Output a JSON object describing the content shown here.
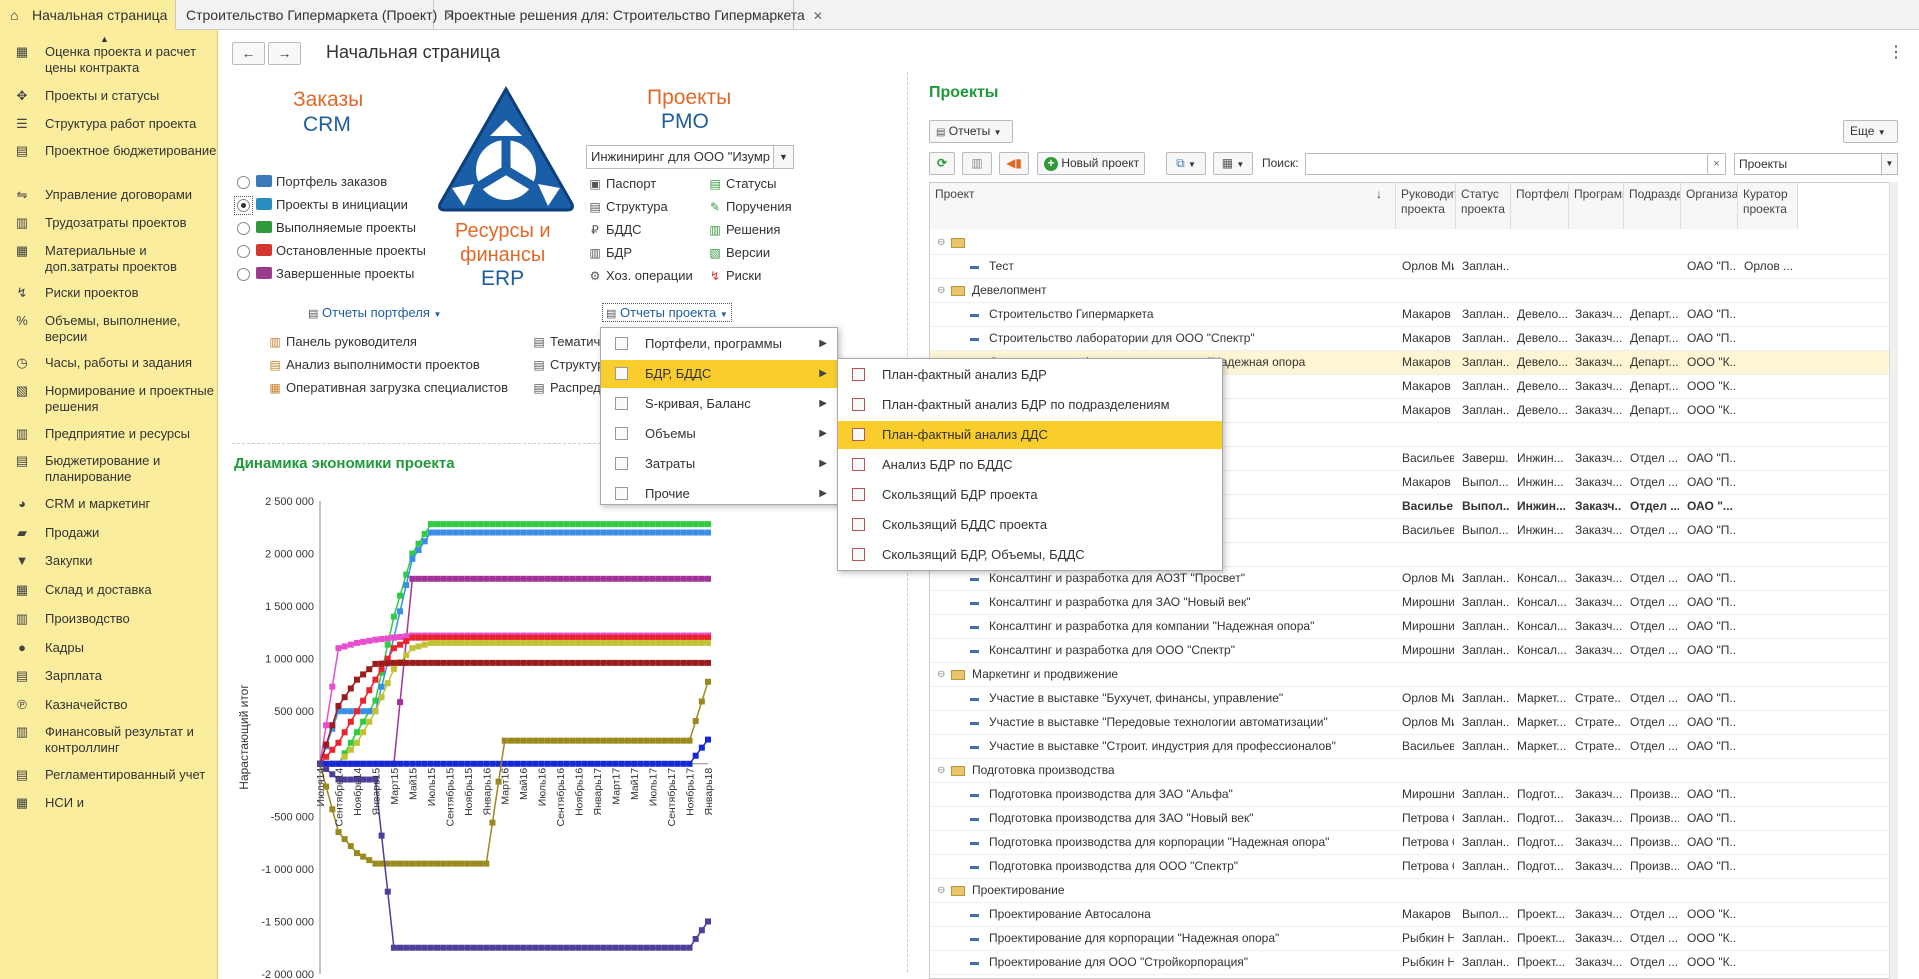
{
  "tabs": [
    {
      "label": "Начальная страница",
      "active": true
    },
    {
      "label": "Строительство Гипермаркета (Проект)"
    },
    {
      "label": "Проектные решения для: Строительство Гипермаркета"
    }
  ],
  "sidebar": [
    {
      "label": "Оценка проекта и расчет цены контракта",
      "icon": "calculator-icon"
    },
    {
      "label": "Проекты и статусы",
      "icon": "projects-icon"
    },
    {
      "label": "Структура работ проекта",
      "icon": "structure-icon"
    },
    {
      "label": "Проектное бюджетирование",
      "icon": "budget-icon"
    },
    {
      "label": "Управление договорами",
      "icon": "handshake-icon"
    },
    {
      "label": "Трудозатраты проектов",
      "icon": "labor-icon"
    },
    {
      "label": "Материальные и доп.затраты проектов",
      "icon": "materials-icon"
    },
    {
      "label": "Риски проектов",
      "icon": "risk-icon"
    },
    {
      "label": "Объемы, выполнение, версии",
      "icon": "percent-icon"
    },
    {
      "label": "Часы, работы и задания",
      "icon": "clock-icon"
    },
    {
      "label": "Нормирование и проектные решения",
      "icon": "norm-icon"
    },
    {
      "label": "Предприятие и ресурсы",
      "icon": "enterprise-icon"
    },
    {
      "label": "Бюджетирование и планирование",
      "icon": "planning-icon"
    },
    {
      "label": "CRM и маркетинг",
      "icon": "crm-icon"
    },
    {
      "label": "Продажи",
      "icon": "sales-icon"
    },
    {
      "label": "Закупки",
      "icon": "cart-icon"
    },
    {
      "label": "Склад и доставка",
      "icon": "warehouse-icon"
    },
    {
      "label": "Производство",
      "icon": "factory-icon"
    },
    {
      "label": "Кадры",
      "icon": "person-icon"
    },
    {
      "label": "Зарплата",
      "icon": "salary-icon"
    },
    {
      "label": "Казначейство",
      "icon": "treasury-icon"
    },
    {
      "label": "Финансовый результат и контроллинг",
      "icon": "chart-icon"
    },
    {
      "label": "Регламентированный учет",
      "icon": "accounting-icon"
    },
    {
      "label": "НСИ и",
      "icon": "nsi-icon"
    }
  ],
  "page": {
    "title": "Начальная страница",
    "back": "←",
    "forward": "→",
    "more": "⋮"
  },
  "brand": {
    "crm_line1": "Заказы",
    "crm_line2": "CRM",
    "pmo_line1": "Проекты",
    "pmo_line2": "PMO",
    "erp_line1": "Ресурсы и",
    "erp_line2": "финансы",
    "erp_line3": "ERP"
  },
  "portfolio": {
    "radios": [
      {
        "label": "Портфель заказов",
        "selected": false,
        "color": "#3a7ab8"
      },
      {
        "label": "Проекты в инициации",
        "selected": true,
        "color": "#2a8fc0"
      },
      {
        "label": "Выполняемые проекты",
        "selected": false,
        "color": "#2f9a3b"
      },
      {
        "label": "Остановленные проекты",
        "selected": false,
        "color": "#d2362f"
      },
      {
        "label": "Завершенные проекты",
        "selected": false,
        "color": "#9b3b8c"
      }
    ],
    "reports_button": "Отчеты портфеля",
    "links": [
      "Панель руководителя",
      "Анализ выполнимости проектов",
      "Оперативная загрузка специалистов"
    ]
  },
  "project": {
    "select_value": "Инжиниринг для ООО \"Изумр",
    "links_col1": [
      "Паспорт",
      "Структура",
      "БДДС",
      "БДР",
      "Хоз. операции"
    ],
    "links_col2": [
      "Статусы",
      "Поручения",
      "Решения",
      "Версии",
      "Риски"
    ],
    "reports_button": "Отчеты проекта",
    "partial_links": [
      "Тематич",
      "Структур",
      "Распред"
    ]
  },
  "menu1": {
    "items": [
      "Портфели, программы",
      "БДР, БДДС",
      "S-кривая, Баланс",
      "Объемы",
      "Затраты",
      "Прочие"
    ],
    "highlight": 1
  },
  "menu2": {
    "items": [
      "План-фактный анализ БДР",
      "План-фактный анализ БДР по подразделениям",
      "План-фактный анализ ДДС",
      "Анализ БДР по БДДС",
      "Скользящий БДР проекта",
      "Скользящий БДДС проекта",
      "Скользящий БДР, Объемы, БДДС"
    ],
    "highlight": 2
  },
  "chart_section": {
    "title": "Динамика экономики проекта"
  },
  "chart_data": {
    "type": "line",
    "ylabel": "Нарастающий итог",
    "yticks": [
      "2 500 000",
      "2 000 000",
      "1 500 000",
      "1 000 000",
      "500 000",
      "-500 000",
      "-1 000 000",
      "-1 500 000",
      "-2 000 000"
    ],
    "ylim": [
      -2000000,
      2500000
    ],
    "categories": [
      "Июль14",
      "Сентябрь14",
      "Ноябрь14",
      "Январь15",
      "Март15",
      "Май15",
      "Июль15",
      "Сентябрь15",
      "Ноябрь15",
      "Январь16",
      "Март16",
      "Май16",
      "Июль16",
      "Сентябрь16",
      "Ноябрь16",
      "Январь17",
      "Март17",
      "Май17",
      "Июль17",
      "Сентябрь17",
      "Ноябрь17",
      "Январь18"
    ],
    "x_labels_shown": [
      "Июля14",
      "Сентябрь14",
      "Ноябрь14",
      "Январь15",
      "Март15",
      "Май15",
      "Июль15",
      "Сентябрь15",
      "Ноябрь15",
      "Январь16",
      "Март16",
      "Май16",
      "Июль16",
      "Сентябрь16",
      "Ноябрь16",
      "Январь17",
      "Март17",
      "Май17",
      "Июль17",
      "Сентябрь17",
      "Ноябрь17",
      "Январь18"
    ],
    "series": [
      {
        "color": "#2ecc40",
        "values": [
          0,
          0,
          300000,
          600000,
          1400000,
          2000000,
          2280000,
          2280000,
          2280000,
          2280000,
          2280000,
          2280000,
          2280000,
          2280000,
          2280000,
          2280000,
          2280000,
          2280000,
          2280000,
          2280000,
          2280000,
          2280000
        ]
      },
      {
        "color": "#3a8ee8",
        "values": [
          0,
          500000,
          500000,
          500000,
          1200000,
          1950000,
          2200000,
          2200000,
          2200000,
          2200000,
          2200000,
          2200000,
          2200000,
          2200000,
          2200000,
          2200000,
          2200000,
          2200000,
          2200000,
          2200000,
          2200000,
          2200000
        ]
      },
      {
        "color": "#a0329a",
        "values": [
          0,
          0,
          0,
          0,
          0,
          1760000,
          1760000,
          1760000,
          1760000,
          1760000,
          1760000,
          1760000,
          1760000,
          1760000,
          1760000,
          1760000,
          1760000,
          1760000,
          1760000,
          1760000,
          1760000,
          1760000
        ]
      },
      {
        "color": "#e84ccf",
        "values": [
          0,
          1100000,
          1150000,
          1180000,
          1200000,
          1220000,
          1220000,
          1220000,
          1220000,
          1220000,
          1220000,
          1220000,
          1220000,
          1220000,
          1220000,
          1220000,
          1220000,
          1220000,
          1220000,
          1220000,
          1220000,
          1220000
        ]
      },
      {
        "color": "#e8252e",
        "values": [
          0,
          200000,
          500000,
          800000,
          1100000,
          1200000,
          1200000,
          1200000,
          1200000,
          1200000,
          1200000,
          1200000,
          1200000,
          1200000,
          1200000,
          1200000,
          1200000,
          1200000,
          1200000,
          1200000,
          1200000,
          1200000
        ]
      },
      {
        "color": "#c2c235",
        "values": [
          0,
          0,
          200000,
          500000,
          900000,
          1100000,
          1150000,
          1150000,
          1150000,
          1150000,
          1150000,
          1150000,
          1150000,
          1150000,
          1150000,
          1150000,
          1150000,
          1150000,
          1150000,
          1150000,
          1150000,
          1150000
        ]
      },
      {
        "color": "#9a1c1c",
        "values": [
          0,
          550000,
          800000,
          950000,
          960000,
          960000,
          960000,
          960000,
          960000,
          960000,
          960000,
          960000,
          960000,
          960000,
          960000,
          960000,
          960000,
          960000,
          960000,
          960000,
          960000,
          960000
        ]
      },
      {
        "color": "#1428d8",
        "values": [
          0,
          0,
          0,
          0,
          0,
          0,
          0,
          0,
          0,
          0,
          0,
          0,
          0,
          0,
          0,
          0,
          0,
          0,
          0,
          0,
          0,
          230000
        ]
      },
      {
        "color": "#9a8a1e",
        "values": [
          0,
          -650000,
          -850000,
          -950000,
          -950000,
          -950000,
          -950000,
          -950000,
          -950000,
          -950000,
          220000,
          220000,
          220000,
          220000,
          220000,
          220000,
          220000,
          220000,
          220000,
          220000,
          220000,
          780000
        ]
      },
      {
        "color": "#4b3f9a",
        "values": [
          0,
          -150000,
          -150000,
          -150000,
          -1750000,
          -1750000,
          -1750000,
          -1750000,
          -1750000,
          -1750000,
          -1750000,
          -1750000,
          -1750000,
          -1750000,
          -1750000,
          -1750000,
          -1750000,
          -1750000,
          -1750000,
          -1750000,
          -1750000,
          -1500000
        ]
      }
    ]
  },
  "right": {
    "title": "Проекты",
    "reports_button": "Отчеты",
    "more_button": "Еще",
    "new_project_button": "Новый проект",
    "search_label": "Поиск:",
    "search_value": "",
    "filter_value": "Проекты",
    "clear": "×"
  },
  "grid": {
    "headers": [
      "Проект",
      "Руководитель проекта",
      "Статус проекта",
      "Портфель",
      "Программа",
      "Подразделение",
      "Организация",
      "Куратор проекта"
    ],
    "rows": [
      {
        "type": "group",
        "name": "",
        "cells": [
          "",
          "",
          "",
          "",
          "",
          "",
          ""
        ]
      },
      {
        "type": "item",
        "name": "Тест",
        "cells": [
          "Орлов Миха...",
          "Заплан...",
          "",
          "",
          "",
          "ОАО \"П...",
          "Орлов ..."
        ]
      },
      {
        "type": "group",
        "name": "Девелопмент",
        "cells": [
          "",
          "",
          "",
          "",
          "",
          "",
          ""
        ]
      },
      {
        "type": "item",
        "name": "Строительство Гипермаркета",
        "cells": [
          "Макаров Ал...",
          "Заплан...",
          "Девело...",
          "Заказч...",
          "Департ...",
          "ОАО \"П...",
          ""
        ]
      },
      {
        "type": "item",
        "name": "Строительство лаборатории для ООО \"Спектр\"",
        "cells": [
          "Макаров Ал...",
          "Заплан...",
          "Девело...",
          "Заказч...",
          "Департ...",
          "ОАО \"П...",
          ""
        ]
      },
      {
        "type": "item",
        "name": "Строительство офиса для корпорации \"Надежная опора",
        "cells": [
          "Макаров Ал...",
          "Заплан...",
          "Девело...",
          "Заказч...",
          "Департ...",
          "ООО \"К...",
          ""
        ],
        "highlight": true
      },
      {
        "type": "item",
        "name": "",
        "cells": [
          "Макаров Ал...",
          "Заплан...",
          "Девело...",
          "Заказч...",
          "Департ...",
          "ООО \"К...",
          ""
        ]
      },
      {
        "type": "item",
        "name": "я ТД \"Западный\"",
        "cells": [
          "Макаров Ал...",
          "Заплан...",
          "Девело...",
          "Заказч...",
          "Департ...",
          "ООО \"К...",
          ""
        ]
      },
      {
        "type": "group",
        "name": "",
        "cells": [
          "",
          "",
          "",
          "",
          "",
          "",
          ""
        ]
      },
      {
        "type": "item",
        "name": "",
        "cells": [
          "Васильев Ан...",
          "Заверш...",
          "Инжин...",
          "Заказч...",
          "Отдел ...",
          "ОАО \"П...",
          ""
        ]
      },
      {
        "type": "item",
        "name": "опора\"",
        "cells": [
          "Макаров Ал...",
          "Выпол...",
          "Инжин...",
          "Заказч...",
          "Отдел ...",
          "ОАО \"П...",
          ""
        ]
      },
      {
        "type": "item",
        "name": "",
        "cells": [
          "Васильев А...",
          "Выпол...",
          "Инжин...",
          "Заказч...",
          "Отдел ...",
          "ОАО \"..."
        ],
        "bold": true
      },
      {
        "type": "item",
        "name": "",
        "cells": [
          "Васильев Ан...",
          "Выпол...",
          "Инжин...",
          "Заказч...",
          "Отдел ...",
          "ОАО \"П...",
          ""
        ]
      },
      {
        "type": "group",
        "name": "",
        "cells": [
          "",
          "",
          "",
          "",
          "",
          "",
          ""
        ]
      },
      {
        "type": "item",
        "name": "Консалтинг и разработка для АОЗТ \"Просвет\"",
        "cells": [
          "Орлов Миха...",
          "Заплан...",
          "Консал...",
          "Заказч...",
          "Отдел ...",
          "ОАО \"П...",
          ""
        ]
      },
      {
        "type": "item",
        "name": "Консалтинг и разработка для ЗАО \"Новый век\"",
        "cells": [
          "Мирошниче...",
          "Заплан...",
          "Консал...",
          "Заказч...",
          "Отдел ...",
          "ОАО \"П...",
          ""
        ]
      },
      {
        "type": "item",
        "name": "Консалтинг и разработка для компании \"Надежная опора\"",
        "cells": [
          "Мирошниче...",
          "Заплан...",
          "Консал...",
          "Заказч...",
          "Отдел ...",
          "ОАО \"П...",
          ""
        ]
      },
      {
        "type": "item",
        "name": "Консалтинг и разработка для ООО \"Спектр\"",
        "cells": [
          "Мирошниче...",
          "Заплан...",
          "Консал...",
          "Заказч...",
          "Отдел ...",
          "ОАО \"П...",
          ""
        ]
      },
      {
        "type": "group",
        "name": "Маркетинг и продвижение",
        "cells": [
          "",
          "",
          "",
          "",
          "",
          "",
          ""
        ]
      },
      {
        "type": "item",
        "name": "Участие в выставке \"Бухучет, финансы, управление\"",
        "cells": [
          "Орлов Миха...",
          "Заплан...",
          "Маркет...",
          "Страте...",
          "Отдел ...",
          "ОАО \"П...",
          ""
        ]
      },
      {
        "type": "item",
        "name": "Участие в выставке \"Передовые технологии автоматизации\"",
        "cells": [
          "Орлов Миха...",
          "Заплан...",
          "Маркет...",
          "Страте...",
          "Отдел ...",
          "ОАО \"П...",
          ""
        ]
      },
      {
        "type": "item",
        "name": "Участие в выставке \"Строит. индустрия для профессионалов\"",
        "cells": [
          "Васильев Ан...",
          "Заплан...",
          "Маркет...",
          "Страте...",
          "Отдел ...",
          "ОАО \"П...",
          ""
        ]
      },
      {
        "type": "group",
        "name": "Подготовка производства",
        "cells": [
          "",
          "",
          "",
          "",
          "",
          "",
          ""
        ]
      },
      {
        "type": "item",
        "name": "Подготовка производства для ЗАО \"Альфа\"",
        "cells": [
          "Мирошниче...",
          "Заплан...",
          "Подгот...",
          "Заказч...",
          "Произв...",
          "ОАО \"П...",
          ""
        ]
      },
      {
        "type": "item",
        "name": "Подготовка производства для ЗАО \"Новый век\"",
        "cells": [
          "Петрова Ол...",
          "Заплан...",
          "Подгот...",
          "Заказч...",
          "Произв...",
          "ОАО \"П...",
          ""
        ]
      },
      {
        "type": "item",
        "name": "Подготовка производства для корпорации \"Надежная опора\"",
        "cells": [
          "Петрова Ол...",
          "Заплан...",
          "Подгот...",
          "Заказч...",
          "Произв...",
          "ОАО \"П...",
          ""
        ]
      },
      {
        "type": "item",
        "name": "Подготовка производства для ООО \"Спектр\"",
        "cells": [
          "Петрова Ол...",
          "Заплан...",
          "Подгот...",
          "Заказч...",
          "Произв...",
          "ОАО \"П...",
          ""
        ]
      },
      {
        "type": "group",
        "name": "Проектирование",
        "cells": [
          "",
          "",
          "",
          "",
          "",
          "",
          ""
        ]
      },
      {
        "type": "item",
        "name": "Проектирование Автосалона",
        "cells": [
          "Макаров Ал...",
          "Выпол...",
          "Проект...",
          "Заказч...",
          "Отдел ...",
          "ООО \"К...",
          ""
        ]
      },
      {
        "type": "item",
        "name": "Проектирование для корпорации \"Надежная опора\"",
        "cells": [
          "Рыбкин Ник...",
          "Заплан...",
          "Проект...",
          "Заказч...",
          "Отдел ...",
          "ООО \"К...",
          ""
        ]
      },
      {
        "type": "item",
        "name": "Проектирование для ООО \"Стройкорпорация\"",
        "cells": [
          "Рыбкин Ник...",
          "Заплан...",
          "Проект...",
          "Заказч...",
          "Отдел ...",
          "ООО \"К...",
          ""
        ]
      }
    ]
  },
  "colors": {
    "accent": "#fbed9e",
    "highlight": "#f9cd2c",
    "green_title": "#1f9a3a",
    "brand_blue": "#1d5d9e",
    "brand_orange": "#e0692a"
  }
}
